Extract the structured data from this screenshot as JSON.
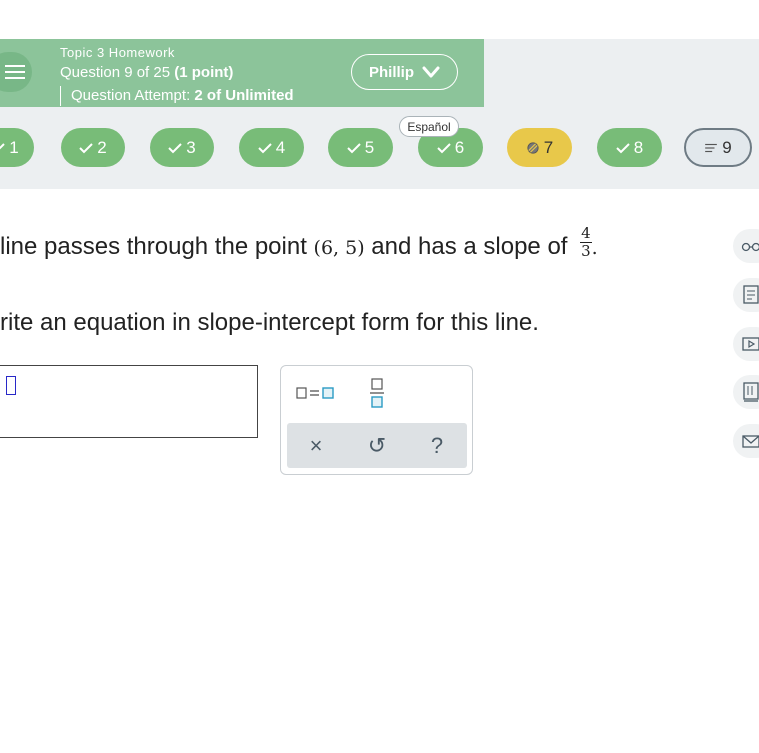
{
  "header": {
    "topic": "Topic 3 Homework",
    "question_prefix": "Question 9 of 25 ",
    "question_points": "(1 point)",
    "attempt_label": "Question Attempt: ",
    "attempt_value": "2 of Unlimited",
    "user_name": "Phillip",
    "colors": {
      "green": "#8cc49a",
      "band": "#eceff1"
    }
  },
  "questions": [
    {
      "label": "1",
      "status": "correct"
    },
    {
      "label": "2",
      "status": "correct"
    },
    {
      "label": "3",
      "status": "correct"
    },
    {
      "label": "4",
      "status": "correct"
    },
    {
      "label": "5",
      "status": "correct"
    },
    {
      "label": "6",
      "status": "correct"
    },
    {
      "label": "7",
      "status": "partial"
    },
    {
      "label": "8",
      "status": "correct"
    },
    {
      "label": "9",
      "status": "current"
    }
  ],
  "language_button": "Español",
  "problem": {
    "line1_start": "line passes through the point ",
    "point": "(6, 5)",
    "line1_mid": " and has a slope of ",
    "slope_num": "4",
    "slope_den": "3",
    "line1_end": ".",
    "line2": "rite an equation in slope-intercept form for this line."
  },
  "palette": {
    "tools": [
      "equation-template-icon",
      "fraction-template-icon"
    ],
    "actions": {
      "clear": "×",
      "undo": "↺",
      "help": "?"
    }
  },
  "side_icons": [
    "glasses-icon",
    "textbook-icon",
    "video-icon",
    "library-icon",
    "mail-icon"
  ]
}
